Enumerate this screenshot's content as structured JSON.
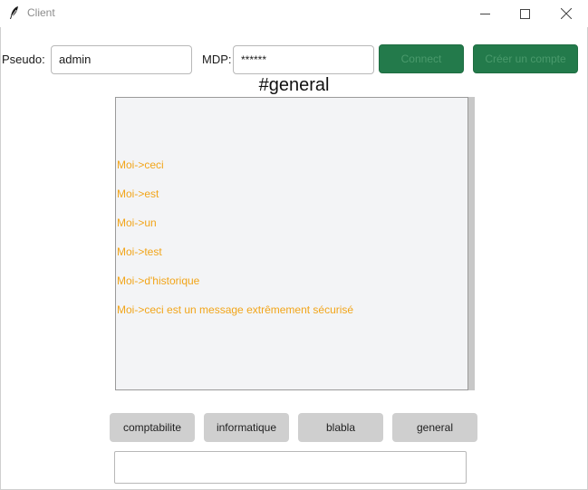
{
  "window": {
    "title": "Client",
    "minimize_icon": "minimize-icon",
    "maximize_icon": "maximize-icon",
    "close_icon": "close-icon"
  },
  "login": {
    "pseudo_label": "Pseudo:",
    "pseudo_value": "admin",
    "mdp_label": "MDP:",
    "mdp_value": "******",
    "connect_label": "Connect",
    "create_label": "Créer un compte",
    "button_color": "#237a4b"
  },
  "channel": {
    "title": "#general"
  },
  "messages": [
    "Moi->ceci",
    "Moi->est",
    "Moi->un",
    "Moi->test",
    "Moi->d'historique",
    "Moi->ceci est un message extrêmement sécurisé"
  ],
  "message_color": "#f2a51a",
  "channels": [
    "comptabilite",
    "informatique",
    "blabla",
    "general"
  ],
  "message_input": {
    "value": ""
  }
}
